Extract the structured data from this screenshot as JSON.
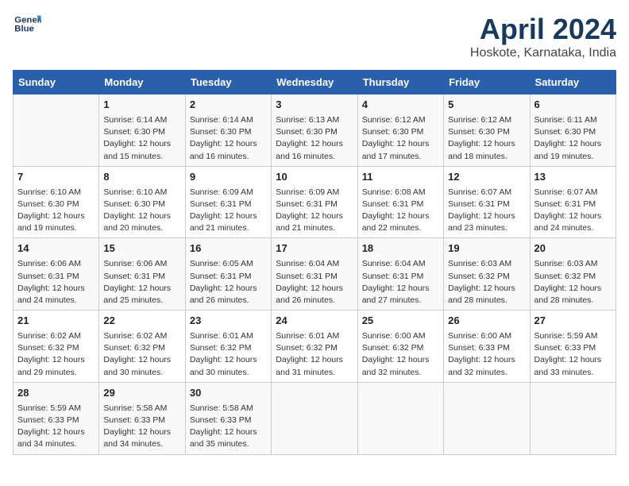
{
  "header": {
    "logo_line1": "General",
    "logo_line2": "Blue",
    "title": "April 2024",
    "subtitle": "Hoskote, Karnataka, India"
  },
  "days_of_week": [
    "Sunday",
    "Monday",
    "Tuesday",
    "Wednesday",
    "Thursday",
    "Friday",
    "Saturday"
  ],
  "weeks": [
    [
      {
        "day": "",
        "info": ""
      },
      {
        "day": "1",
        "info": "Sunrise: 6:14 AM\nSunset: 6:30 PM\nDaylight: 12 hours\nand 15 minutes."
      },
      {
        "day": "2",
        "info": "Sunrise: 6:14 AM\nSunset: 6:30 PM\nDaylight: 12 hours\nand 16 minutes."
      },
      {
        "day": "3",
        "info": "Sunrise: 6:13 AM\nSunset: 6:30 PM\nDaylight: 12 hours\nand 16 minutes."
      },
      {
        "day": "4",
        "info": "Sunrise: 6:12 AM\nSunset: 6:30 PM\nDaylight: 12 hours\nand 17 minutes."
      },
      {
        "day": "5",
        "info": "Sunrise: 6:12 AM\nSunset: 6:30 PM\nDaylight: 12 hours\nand 18 minutes."
      },
      {
        "day": "6",
        "info": "Sunrise: 6:11 AM\nSunset: 6:30 PM\nDaylight: 12 hours\nand 19 minutes."
      }
    ],
    [
      {
        "day": "7",
        "info": "Sunrise: 6:10 AM\nSunset: 6:30 PM\nDaylight: 12 hours\nand 19 minutes."
      },
      {
        "day": "8",
        "info": "Sunrise: 6:10 AM\nSunset: 6:30 PM\nDaylight: 12 hours\nand 20 minutes."
      },
      {
        "day": "9",
        "info": "Sunrise: 6:09 AM\nSunset: 6:31 PM\nDaylight: 12 hours\nand 21 minutes."
      },
      {
        "day": "10",
        "info": "Sunrise: 6:09 AM\nSunset: 6:31 PM\nDaylight: 12 hours\nand 21 minutes."
      },
      {
        "day": "11",
        "info": "Sunrise: 6:08 AM\nSunset: 6:31 PM\nDaylight: 12 hours\nand 22 minutes."
      },
      {
        "day": "12",
        "info": "Sunrise: 6:07 AM\nSunset: 6:31 PM\nDaylight: 12 hours\nand 23 minutes."
      },
      {
        "day": "13",
        "info": "Sunrise: 6:07 AM\nSunset: 6:31 PM\nDaylight: 12 hours\nand 24 minutes."
      }
    ],
    [
      {
        "day": "14",
        "info": "Sunrise: 6:06 AM\nSunset: 6:31 PM\nDaylight: 12 hours\nand 24 minutes."
      },
      {
        "day": "15",
        "info": "Sunrise: 6:06 AM\nSunset: 6:31 PM\nDaylight: 12 hours\nand 25 minutes."
      },
      {
        "day": "16",
        "info": "Sunrise: 6:05 AM\nSunset: 6:31 PM\nDaylight: 12 hours\nand 26 minutes."
      },
      {
        "day": "17",
        "info": "Sunrise: 6:04 AM\nSunset: 6:31 PM\nDaylight: 12 hours\nand 26 minutes."
      },
      {
        "day": "18",
        "info": "Sunrise: 6:04 AM\nSunset: 6:31 PM\nDaylight: 12 hours\nand 27 minutes."
      },
      {
        "day": "19",
        "info": "Sunrise: 6:03 AM\nSunset: 6:32 PM\nDaylight: 12 hours\nand 28 minutes."
      },
      {
        "day": "20",
        "info": "Sunrise: 6:03 AM\nSunset: 6:32 PM\nDaylight: 12 hours\nand 28 minutes."
      }
    ],
    [
      {
        "day": "21",
        "info": "Sunrise: 6:02 AM\nSunset: 6:32 PM\nDaylight: 12 hours\nand 29 minutes."
      },
      {
        "day": "22",
        "info": "Sunrise: 6:02 AM\nSunset: 6:32 PM\nDaylight: 12 hours\nand 30 minutes."
      },
      {
        "day": "23",
        "info": "Sunrise: 6:01 AM\nSunset: 6:32 PM\nDaylight: 12 hours\nand 30 minutes."
      },
      {
        "day": "24",
        "info": "Sunrise: 6:01 AM\nSunset: 6:32 PM\nDaylight: 12 hours\nand 31 minutes."
      },
      {
        "day": "25",
        "info": "Sunrise: 6:00 AM\nSunset: 6:32 PM\nDaylight: 12 hours\nand 32 minutes."
      },
      {
        "day": "26",
        "info": "Sunrise: 6:00 AM\nSunset: 6:33 PM\nDaylight: 12 hours\nand 32 minutes."
      },
      {
        "day": "27",
        "info": "Sunrise: 5:59 AM\nSunset: 6:33 PM\nDaylight: 12 hours\nand 33 minutes."
      }
    ],
    [
      {
        "day": "28",
        "info": "Sunrise: 5:59 AM\nSunset: 6:33 PM\nDaylight: 12 hours\nand 34 minutes."
      },
      {
        "day": "29",
        "info": "Sunrise: 5:58 AM\nSunset: 6:33 PM\nDaylight: 12 hours\nand 34 minutes."
      },
      {
        "day": "30",
        "info": "Sunrise: 5:58 AM\nSunset: 6:33 PM\nDaylight: 12 hours\nand 35 minutes."
      },
      {
        "day": "",
        "info": ""
      },
      {
        "day": "",
        "info": ""
      },
      {
        "day": "",
        "info": ""
      },
      {
        "day": "",
        "info": ""
      }
    ]
  ]
}
